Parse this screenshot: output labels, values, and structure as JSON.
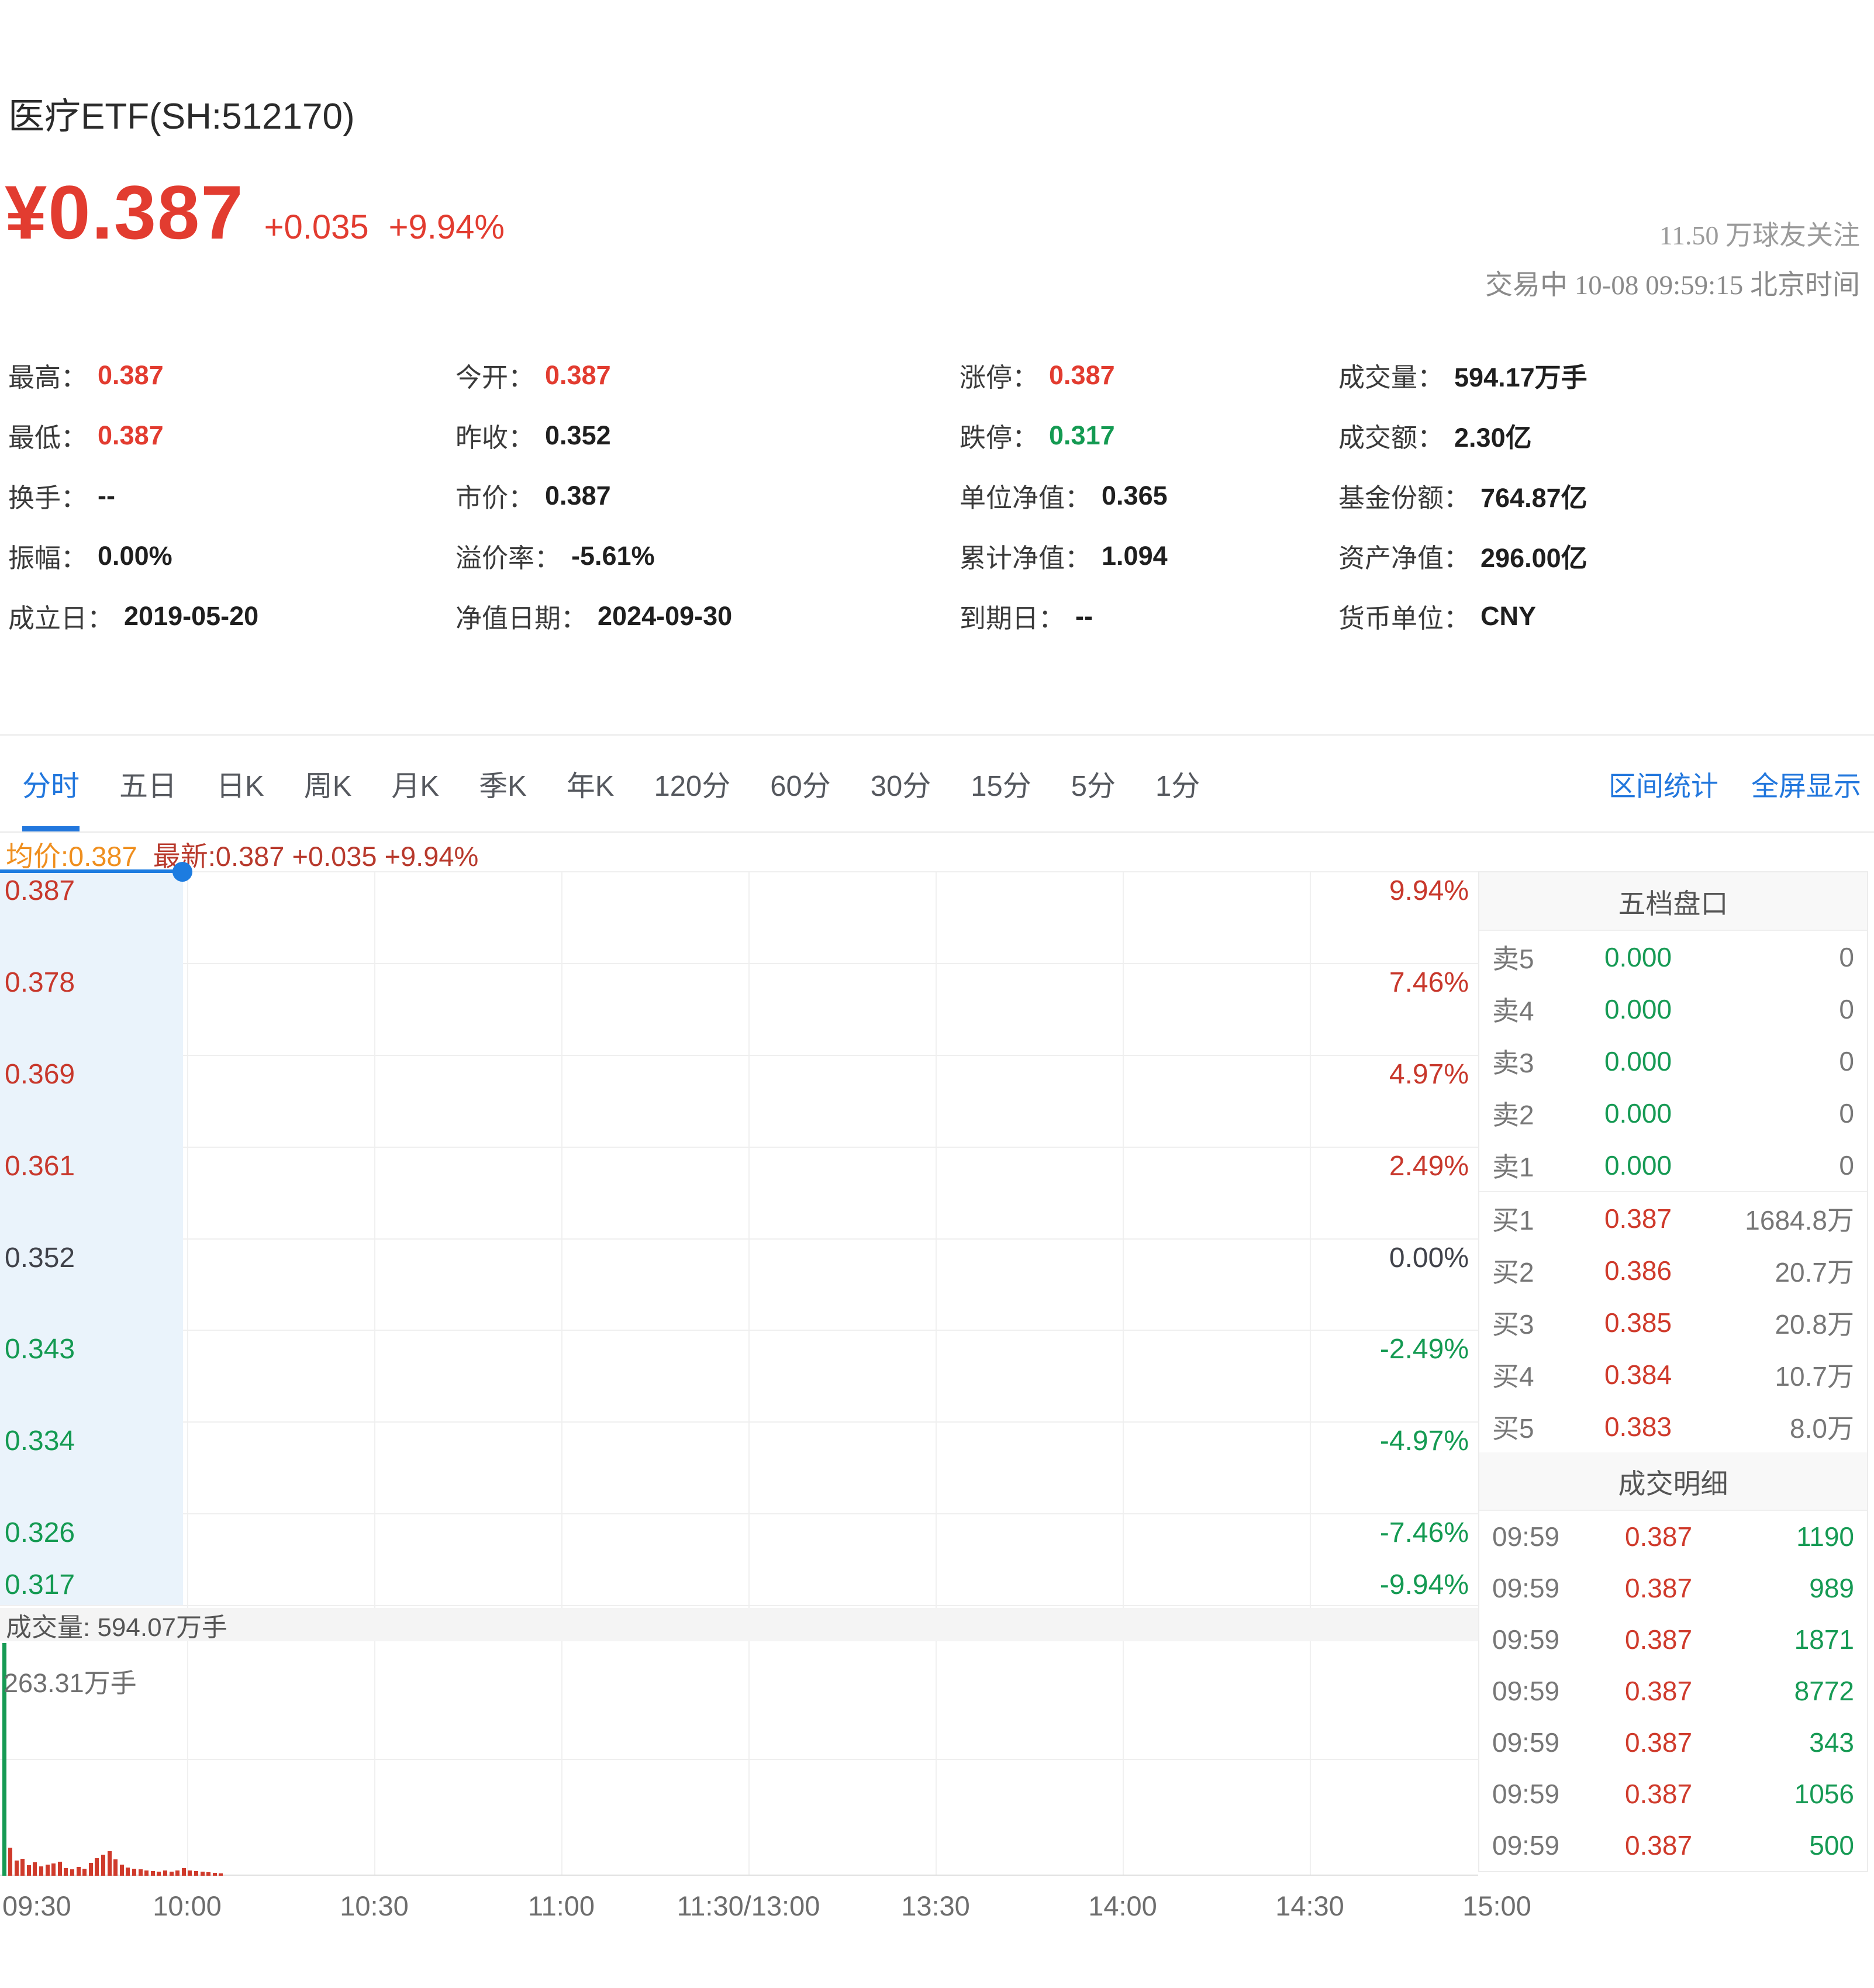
{
  "colors": {
    "up": "#e23c30",
    "down": "#149a52",
    "flat": "#40424a",
    "accent_blue": "#2277dd",
    "avg_orange": "#ef8f1f",
    "legend_red": "#b8392c",
    "line_blue": "#1d7ce0",
    "fill_blue": "#eaf3fb"
  },
  "header": {
    "title": "医疗ETF(SH:512170)",
    "price": "¥0.387",
    "change_value": "+0.035",
    "change_percent": "+9.94%",
    "watchers": "11.50 万球友关注",
    "status_line": "交易中 10-08 09:59:15 北京时间"
  },
  "stats": {
    "items": [
      {
        "label": "最高：",
        "value": "0.387"
      },
      {
        "label": "今开：",
        "value": "0.387"
      },
      {
        "label": "涨停：",
        "value": "0.387"
      },
      {
        "label": "成交量：",
        "value": "594.17万手"
      },
      {
        "label": "最低：",
        "value": "0.387"
      },
      {
        "label": "昨收：",
        "value": "0.352"
      },
      {
        "label": "跌停：",
        "value": "0.317"
      },
      {
        "label": "成交额：",
        "value": "2.30亿"
      },
      {
        "label": "换手：",
        "value": "--"
      },
      {
        "label": "市价：",
        "value": "0.387"
      },
      {
        "label": "单位净值：",
        "value": "0.365"
      },
      {
        "label": "基金份额：",
        "value": "764.87亿"
      },
      {
        "label": "振幅：",
        "value": "0.00%"
      },
      {
        "label": "溢价率：",
        "value": "-5.61%"
      },
      {
        "label": "累计净值：",
        "value": "1.094"
      },
      {
        "label": "资产净值：",
        "value": "296.00亿"
      },
      {
        "label": "成立日：",
        "value": "2019-05-20"
      },
      {
        "label": "净值日期：",
        "value": "2024-09-30"
      },
      {
        "label": "到期日：",
        "value": "--"
      },
      {
        "label": "货币单位：",
        "value": "CNY"
      }
    ]
  },
  "tabs": {
    "items": [
      "分时",
      "五日",
      "日K",
      "周K",
      "月K",
      "季K",
      "年K",
      "120分",
      "60分",
      "30分",
      "15分",
      "5分",
      "1分"
    ],
    "active": "分时",
    "links": [
      "区间统计",
      "全屏显示"
    ]
  },
  "legend": {
    "avg": "均价:0.387",
    "latest": "最新:0.387 +0.035 +9.94%"
  },
  "chart_data": {
    "type": "line",
    "title": "分时图 (intraday)",
    "x_axis_labels": [
      "09:30",
      "10:00",
      "10:30",
      "11:00",
      "11:30/13:00",
      "13:30",
      "14:00",
      "14:30",
      "15:00"
    ],
    "left_axis_price_labels": [
      "0.387",
      "0.378",
      "0.369",
      "0.361",
      "0.352",
      "0.343",
      "0.334",
      "0.326",
      "0.317"
    ],
    "right_axis_percent_labels": [
      "9.94%",
      "7.46%",
      "4.97%",
      "2.49%",
      "0.00%",
      "-2.49%",
      "-4.97%",
      "-7.46%",
      "-9.94%"
    ],
    "ylim_price": [
      0.317,
      0.387
    ],
    "prev_close": 0.352,
    "series": [
      {
        "name": "最新",
        "x": [
          "09:30",
          "09:59"
        ],
        "values": [
          0.387,
          0.387
        ]
      },
      {
        "name": "均价",
        "x": [
          "09:30",
          "09:59"
        ],
        "values": [
          0.387,
          0.387
        ]
      }
    ],
    "last_point": {
      "time": "09:59",
      "price": 0.387,
      "percent": "+9.94%"
    },
    "volume": {
      "title": "成交量: 594.07万手",
      "axis_max_label": "263.31万手",
      "green_bar_height": 398,
      "red_bar_heights": [
        48,
        26,
        29,
        18,
        23,
        16,
        19,
        21,
        24,
        13,
        11,
        15,
        12,
        22,
        30,
        36,
        42,
        28,
        19,
        14,
        12,
        11,
        9,
        8,
        7,
        9,
        7,
        9,
        13,
        9,
        8,
        7,
        6,
        5,
        4
      ]
    }
  },
  "order_book": {
    "title": "五档盘口",
    "sells": [
      {
        "label": "卖5",
        "price": "0.000",
        "qty": "0"
      },
      {
        "label": "卖4",
        "price": "0.000",
        "qty": "0"
      },
      {
        "label": "卖3",
        "price": "0.000",
        "qty": "0"
      },
      {
        "label": "卖2",
        "price": "0.000",
        "qty": "0"
      },
      {
        "label": "卖1",
        "price": "0.000",
        "qty": "0"
      }
    ],
    "buys": [
      {
        "label": "买1",
        "price": "0.387",
        "qty": "1684.8万"
      },
      {
        "label": "买2",
        "price": "0.386",
        "qty": "20.7万"
      },
      {
        "label": "买3",
        "price": "0.385",
        "qty": "20.8万"
      },
      {
        "label": "买4",
        "price": "0.384",
        "qty": "10.7万"
      },
      {
        "label": "买5",
        "price": "0.383",
        "qty": "8.0万"
      }
    ]
  },
  "trades": {
    "title": "成交明细",
    "rows": [
      {
        "time": "09:59",
        "price": "0.387",
        "qty": "1190"
      },
      {
        "time": "09:59",
        "price": "0.387",
        "qty": "989"
      },
      {
        "time": "09:59",
        "price": "0.387",
        "qty": "1871"
      },
      {
        "time": "09:59",
        "price": "0.387",
        "qty": "8772"
      },
      {
        "time": "09:59",
        "price": "0.387",
        "qty": "343"
      },
      {
        "time": "09:59",
        "price": "0.387",
        "qty": "1056"
      },
      {
        "time": "09:59",
        "price": "0.387",
        "qty": "500"
      }
    ]
  }
}
